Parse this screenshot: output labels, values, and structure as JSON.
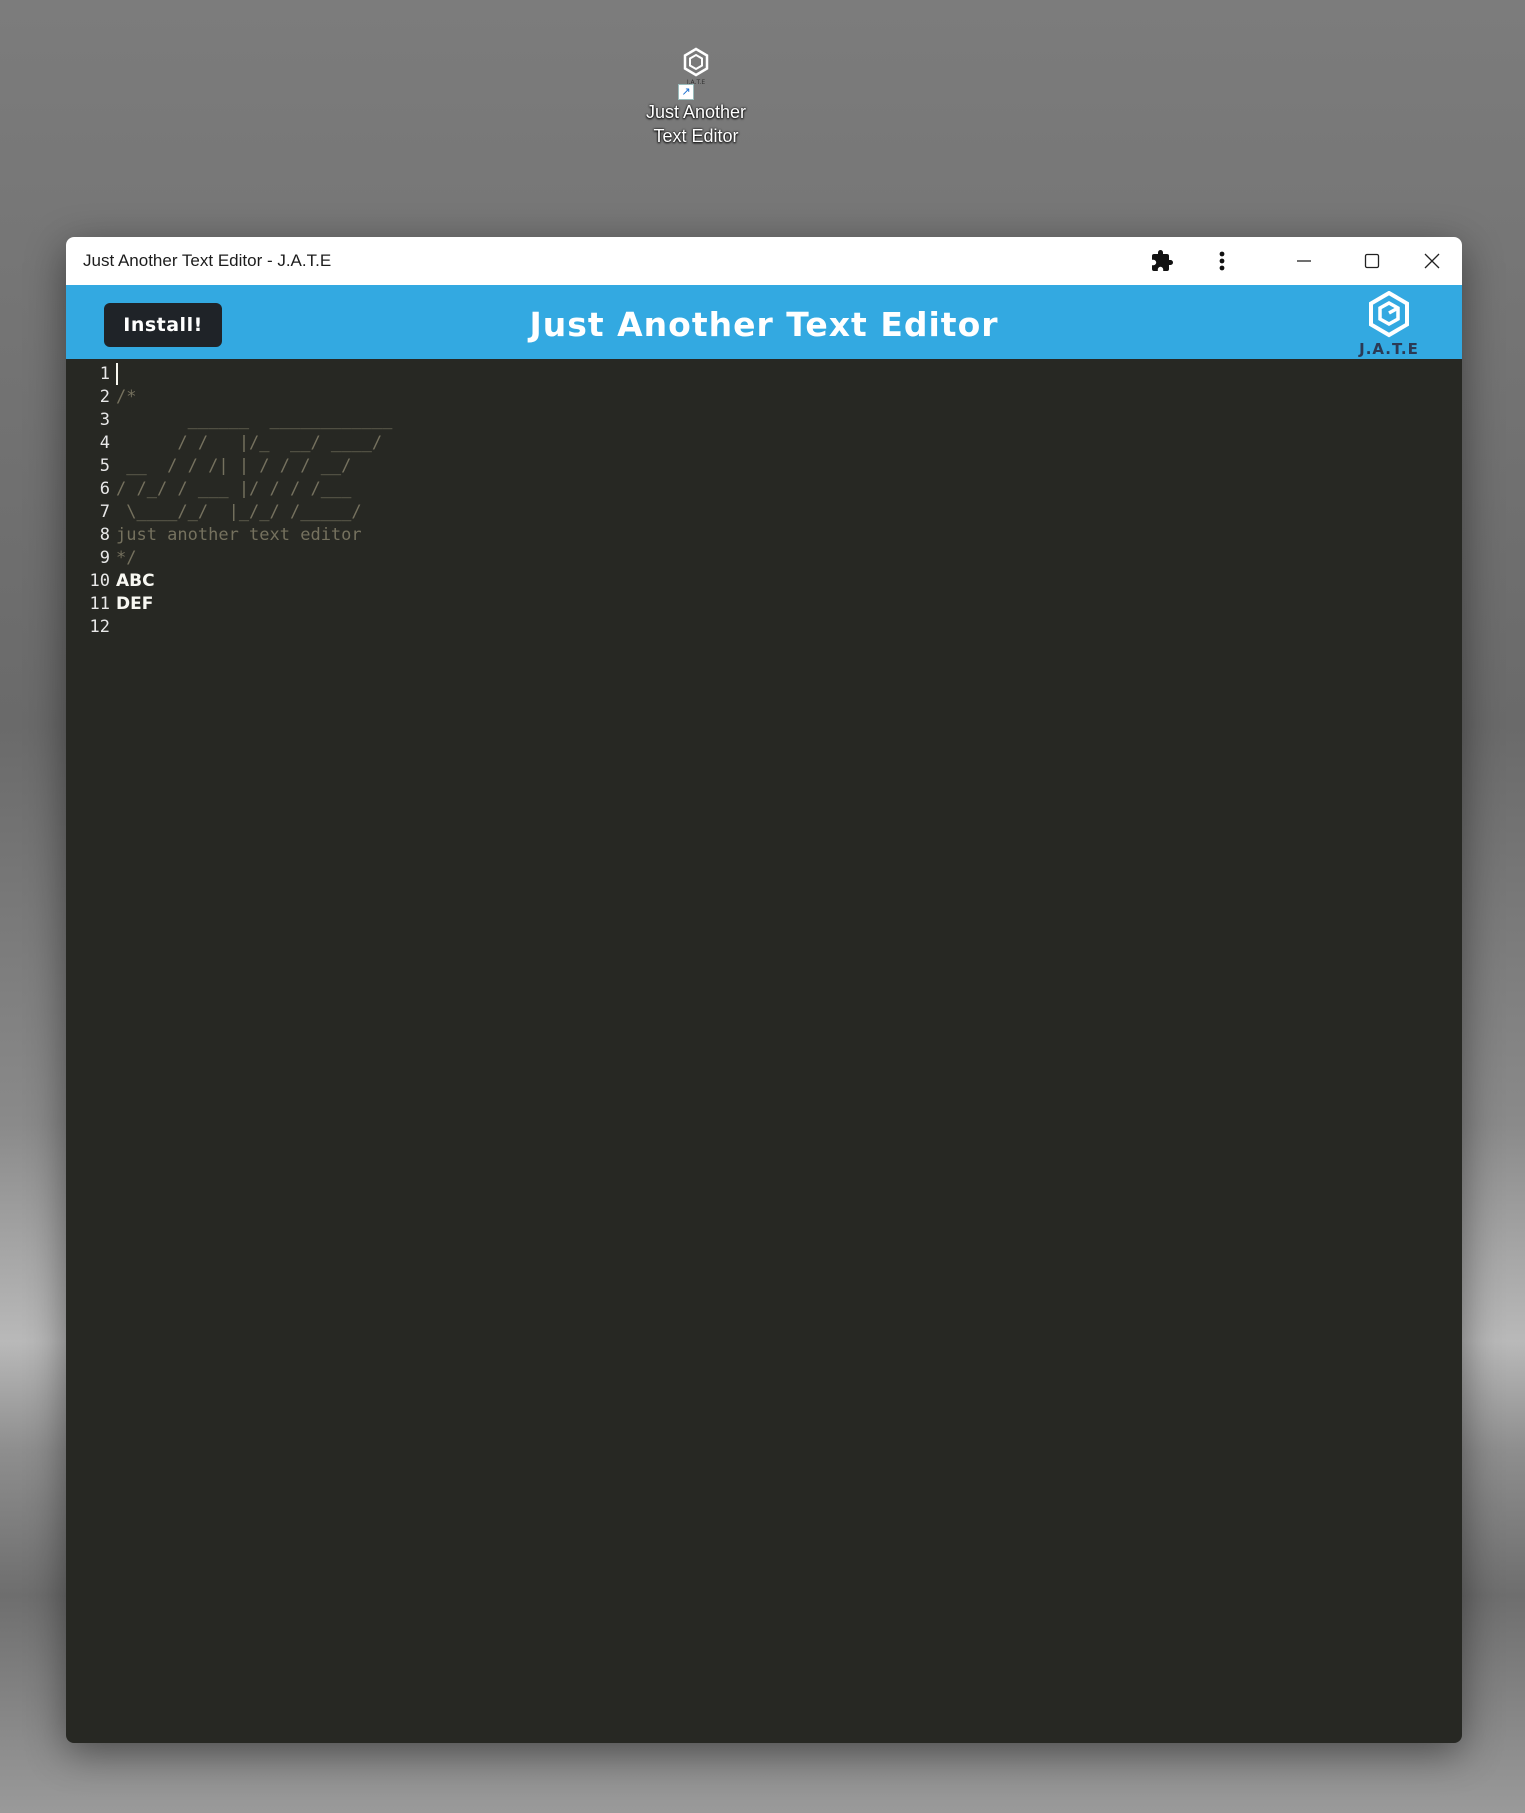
{
  "desktop": {
    "shortcut_label_line1": "Just Another",
    "shortcut_label_line2": "Text Editor",
    "shortcut_logo_text": "J.A.T.E"
  },
  "window": {
    "title": "Just Another Text Editor - J.A.T.E",
    "icons": [
      "extensions-icon",
      "more-menu-icon",
      "minimize-icon",
      "maximize-icon",
      "close-icon"
    ]
  },
  "header": {
    "install_label": "Install!",
    "app_title": "Just Another Text Editor",
    "logo_text": "J.A.T.E",
    "background_color": "#33a9e1"
  },
  "editor": {
    "background_color": "#272823",
    "line_numbers": [
      "1",
      "2",
      "3",
      "4",
      "5",
      "6",
      "7",
      "8",
      "9",
      "10",
      "11",
      "12"
    ],
    "lines": [
      "",
      "/*",
      "       ______  ____________",
      "      / /   |/_  __/ ____/",
      " __  / / /| | / / / __/",
      "/ /_/ / ___ |/ / / /___",
      " \\____/_/  |_/_/ /_____/",
      "just another text editor",
      "*/",
      "ABC",
      "DEF",
      ""
    ]
  }
}
